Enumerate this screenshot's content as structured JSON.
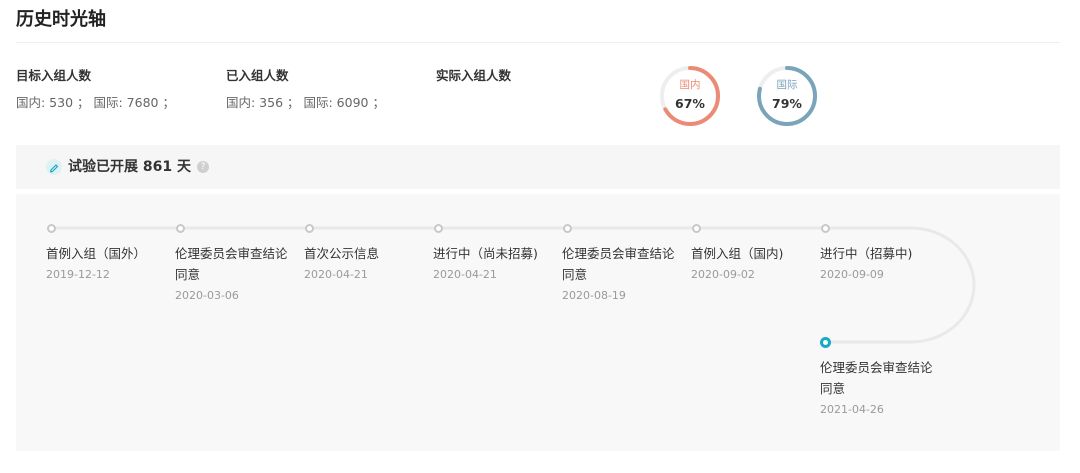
{
  "page": {
    "title": "历史时光轴"
  },
  "stats": {
    "target": {
      "label": "目标入组人数",
      "value": "国内: 530 ；  国际: 7680 ；"
    },
    "enrolled": {
      "label": "已入组人数",
      "value": "国内: 356 ；  国际: 6090 ；"
    },
    "actual": {
      "label": "实际入组人数"
    }
  },
  "rings": [
    {
      "label": "国内",
      "percent_text": "67%",
      "fraction": 0.67,
      "color": "#ec8b75"
    },
    {
      "label": "国际",
      "percent_text": "79%",
      "fraction": 0.79,
      "color": "#7aa4ba"
    }
  ],
  "trial": {
    "days_text": "试验已开展 861 天",
    "icon": "pencil-icon",
    "help_icon": "question-icon",
    "help_glyph": "?"
  },
  "timeline": {
    "track_color": "#e9e9e9",
    "active_color": "#1aa9c4",
    "events": [
      {
        "title": "首例入组（国外）",
        "date": "2019-12-12",
        "active": false
      },
      {
        "title": "伦理委员会审查结论同意",
        "date": "2020-03-06",
        "active": false
      },
      {
        "title": "首次公示信息",
        "date": "2020-04-21",
        "active": false
      },
      {
        "title": "进行中（尚未招募)",
        "date": "2020-04-21",
        "active": false
      },
      {
        "title": "伦理委员会审查结论同意",
        "date": "2020-08-19",
        "active": false
      },
      {
        "title": "首例入组（国内)",
        "date": "2020-09-02",
        "active": false
      },
      {
        "title": "进行中（招募中)",
        "date": "2020-09-09",
        "active": false
      },
      {
        "title": "伦理委员会审查结论同意",
        "date": "2021-04-26",
        "active": true
      }
    ]
  }
}
